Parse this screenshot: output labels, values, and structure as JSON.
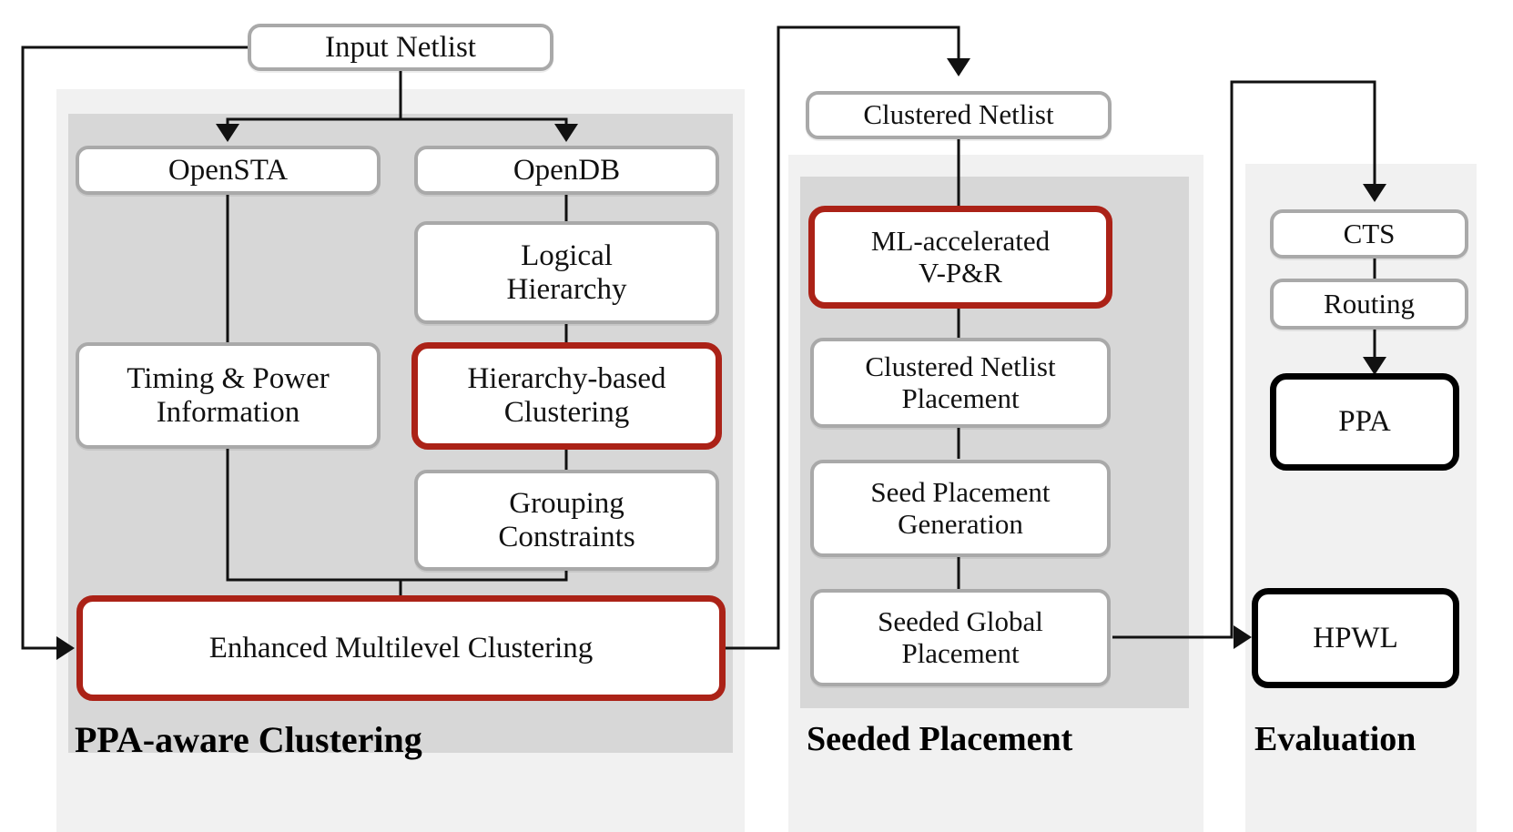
{
  "diagram": {
    "title": "PPA-aware Clustering / Seeded Placement / Evaluation flow",
    "colors": {
      "highlight_red": "#ab2217",
      "emphasis_black": "#000000",
      "node_border_gray": "#a9a9a9",
      "panel_outer": "#f1f1f1",
      "panel_inner": "#d7d7d7",
      "node_fill": "#ffffff",
      "connector": "#111111"
    },
    "groups": [
      {
        "id": "clustering",
        "caption": "PPA-aware Clustering"
      },
      {
        "id": "placement",
        "caption": "Seeded Placement"
      },
      {
        "id": "evaluation",
        "caption": "Evaluation"
      }
    ],
    "nodes": {
      "input_netlist": "Input Netlist",
      "opensta": "OpenSTA",
      "opendb": "OpenDB",
      "logical_hierarchy_l1": "Logical",
      "logical_hierarchy_l2": "Hierarchy",
      "timing_power_l1": "Timing & Power",
      "timing_power_l2": "Information",
      "hierarchy_clustering_l1": "Hierarchy-based",
      "hierarchy_clustering_l2": "Clustering",
      "grouping_constraints_l1": "Grouping",
      "grouping_constraints_l2": "Constraints",
      "enhanced_multilevel": "Enhanced Multilevel Clustering",
      "clustered_netlist": "Clustered Netlist",
      "ml_vpr_l1": "ML-accelerated",
      "ml_vpr_l2": "V-P&R",
      "clustered_netlist_placement_l1": "Clustered Netlist",
      "clustered_netlist_placement_l2": "Placement",
      "seed_placement_generation_l1": "Seed Placement",
      "seed_placement_generation_l2": "Generation",
      "seeded_global_placement_l1": "Seeded Global",
      "seeded_global_placement_l2": "Placement",
      "cts": "CTS",
      "routing": "Routing",
      "ppa": "PPA",
      "hpwl": "HPWL"
    }
  }
}
